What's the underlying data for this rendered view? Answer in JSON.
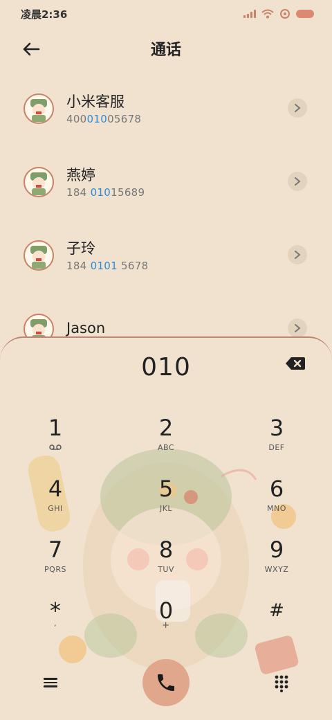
{
  "status_bar": {
    "time": "凌晨2:36"
  },
  "header": {
    "title": "通话"
  },
  "contacts": [
    {
      "name": "小米客服",
      "number_pre": "400",
      "number_match": "010",
      "number_post": "05678"
    },
    {
      "name": "燕婷",
      "number_pre": "184 ",
      "number_match": "010",
      "number_post": "15689"
    },
    {
      "name": "子玲",
      "number_pre": "184 ",
      "number_match": "0101",
      "number_post": " 5678"
    },
    {
      "name": "Jason",
      "number_pre": "",
      "number_match": "",
      "number_post": ""
    }
  ],
  "dialer": {
    "input": "010",
    "keys": [
      {
        "digit": "1",
        "letters": ""
      },
      {
        "digit": "2",
        "letters": "ABC"
      },
      {
        "digit": "3",
        "letters": "DEF"
      },
      {
        "digit": "4",
        "letters": "GHI"
      },
      {
        "digit": "5",
        "letters": "JKL"
      },
      {
        "digit": "6",
        "letters": "MNO"
      },
      {
        "digit": "7",
        "letters": "PQRS"
      },
      {
        "digit": "8",
        "letters": "TUV"
      },
      {
        "digit": "9",
        "letters": "WXYZ"
      },
      {
        "digit": "*",
        "letters": ","
      },
      {
        "digit": "0",
        "letters": "+"
      },
      {
        "digit": "#",
        "letters": ""
      }
    ]
  },
  "colors": {
    "accent": "#e0a78d",
    "highlight": "#2a8ad8",
    "background": "#f0e2cf"
  }
}
